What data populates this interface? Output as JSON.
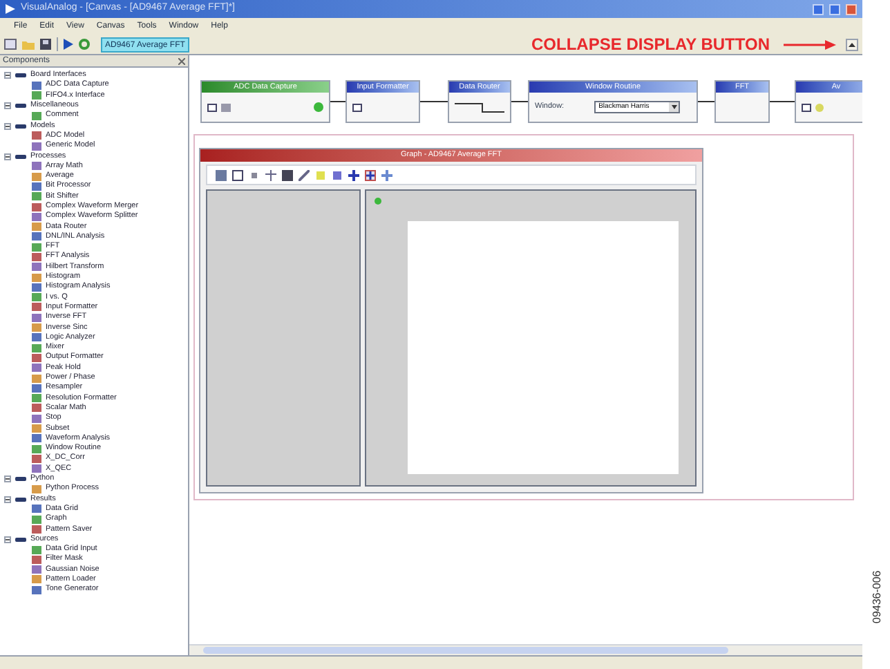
{
  "window": {
    "title": "VisualAnalog - [Canvas - [AD9467 Average FFT]*]"
  },
  "menu": [
    "File",
    "Edit",
    "View",
    "Canvas",
    "Tools",
    "Window",
    "Help"
  ],
  "toolbar": {
    "canvas_tab": "AD9467 Average FFT"
  },
  "annotation": {
    "text": "COLLAPSE DISPLAY BUTTON"
  },
  "components_panel": {
    "title": "Components",
    "tree": [
      {
        "label": "Board Interfaces",
        "expanded": true,
        "children": [
          {
            "label": "ADC Data Capture"
          },
          {
            "label": "FIFO4.x Interface"
          }
        ]
      },
      {
        "label": "Miscellaneous",
        "expanded": true,
        "children": [
          {
            "label": "Comment"
          }
        ]
      },
      {
        "label": "Models",
        "expanded": true,
        "children": [
          {
            "label": "ADC Model"
          },
          {
            "label": "Generic Model"
          }
        ]
      },
      {
        "label": "Processes",
        "expanded": true,
        "children": [
          {
            "label": "Array Math"
          },
          {
            "label": "Average"
          },
          {
            "label": "Bit Processor"
          },
          {
            "label": "Bit Shifter"
          },
          {
            "label": "Complex Waveform Merger"
          },
          {
            "label": "Complex Waveform Splitter"
          },
          {
            "label": "Data Router"
          },
          {
            "label": "DNL/INL Analysis"
          },
          {
            "label": "FFT"
          },
          {
            "label": "FFT Analysis"
          },
          {
            "label": "Hilbert Transform"
          },
          {
            "label": "Histogram"
          },
          {
            "label": "Histogram Analysis"
          },
          {
            "label": "I vs. Q"
          },
          {
            "label": "Input Formatter"
          },
          {
            "label": "Inverse FFT"
          },
          {
            "label": "Inverse Sinc"
          },
          {
            "label": "Logic Analyzer"
          },
          {
            "label": "Mixer"
          },
          {
            "label": "Output Formatter"
          },
          {
            "label": "Peak Hold"
          },
          {
            "label": "Power / Phase"
          },
          {
            "label": "Resampler"
          },
          {
            "label": "Resolution Formatter"
          },
          {
            "label": "Scalar Math"
          },
          {
            "label": "Stop"
          },
          {
            "label": "Subset"
          },
          {
            "label": "Waveform Analysis"
          },
          {
            "label": "Window Routine"
          },
          {
            "label": "X_DC_Corr"
          },
          {
            "label": "X_QEC"
          }
        ]
      },
      {
        "label": "Python",
        "expanded": true,
        "children": [
          {
            "label": "Python Process"
          }
        ]
      },
      {
        "label": "Results",
        "expanded": true,
        "children": [
          {
            "label": "Data Grid"
          },
          {
            "label": "Graph"
          },
          {
            "label": "Pattern Saver"
          }
        ]
      },
      {
        "label": "Sources",
        "expanded": true,
        "children": [
          {
            "label": "Data Grid Input"
          },
          {
            "label": "Filter Mask"
          },
          {
            "label": "Gaussian Noise"
          },
          {
            "label": "Pattern Loader"
          },
          {
            "label": "Tone Generator"
          }
        ]
      }
    ]
  },
  "canvas": {
    "blocks": [
      {
        "title": "ADC Data Capture",
        "kind": "capture"
      },
      {
        "title": "Input Formatter",
        "kind": "formatter"
      },
      {
        "title": "Data Router",
        "kind": "router"
      },
      {
        "title": "Window Routine",
        "kind": "window",
        "field_label": "Window:",
        "value": "Blackman Harris"
      },
      {
        "title": "FFT",
        "kind": "fft"
      },
      {
        "title": "Av",
        "kind": "analysis"
      }
    ],
    "graph": {
      "title": "Graph - AD9467 Average FFT"
    }
  },
  "figure_id": "09436-006"
}
